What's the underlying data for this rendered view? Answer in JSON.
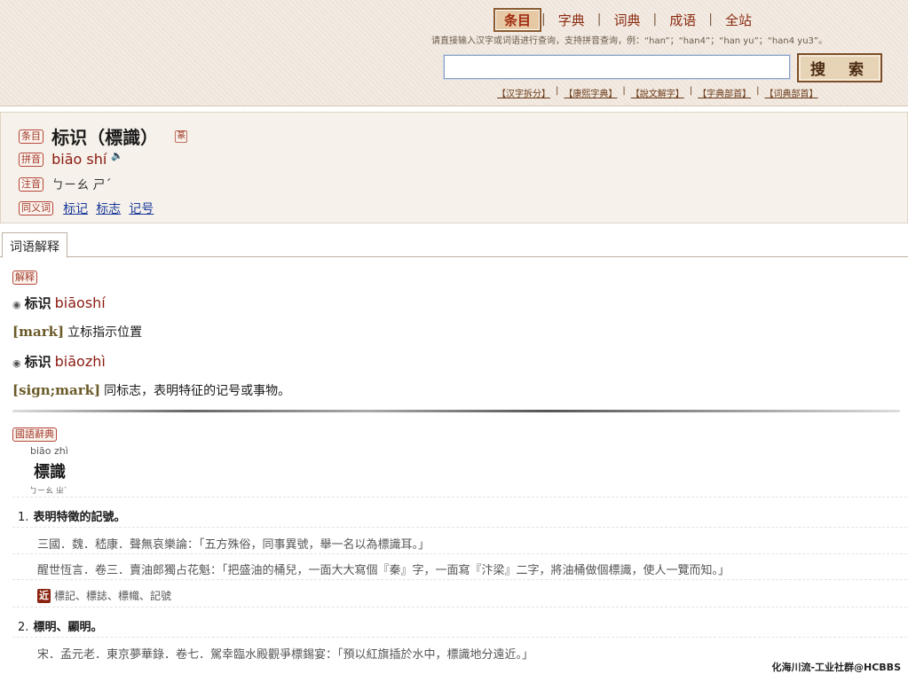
{
  "header": {
    "nav": {
      "active": "条目",
      "items": [
        "字典",
        "词典",
        "成语",
        "全站"
      ]
    },
    "hint": "请直接输入汉字或词语进行查询，支持拼音查询，例：“han”；“han4”；“han yu”；“han4 yu3”。",
    "search": {
      "value": "",
      "button": "搜 索"
    },
    "links": [
      "【汉字拆分】",
      "【康熙字典】",
      "【說文解字】",
      "【字典部首】",
      "【词典部首】"
    ]
  },
  "entry": {
    "tag_title": "条目",
    "title": "标识（標識）",
    "seal_icon": "篆",
    "tag_pinyin": "拼音",
    "pinyin": "biāo shí",
    "speaker_glyph": "🔈",
    "tag_zhuyin": "注音",
    "zhuyin": "ㄅㄧㄠ ㄕˊ",
    "tag_synonym": "同义词",
    "synonyms": [
      "标记",
      "标志",
      "记号"
    ]
  },
  "tabs": {
    "active": "词语解释"
  },
  "definition": {
    "tag": "解释",
    "items": [
      {
        "headword": "标识",
        "pinyin": "biāoshí",
        "english": "[mark]",
        "chinese": "立标指示位置"
      },
      {
        "headword": "标识",
        "pinyin": "biāozhì",
        "english": "[sign;mark]",
        "chinese": "同标志，表明特征的记号或事物。"
      }
    ]
  },
  "guoyu": {
    "tag": "國語辭典",
    "pinyin": "biāo zhì",
    "word": "標識",
    "zhuyin": "ㄅㄧㄠ ㄓˋ",
    "senses": [
      {
        "num": "1.",
        "text": "表明特徵的記號。",
        "quotes": [
          "三國．魏．嵇康．聲無哀樂論：「五方殊俗，同事異號，舉一名以為標識耳。」",
          "醒世恆言．卷三．賣油郎獨占花魁：「把盛油的桶兒，一面大大寫個『秦』字，一面寫『汴梁』二字，將油桶做個標識，使人一覽而知。」"
        ],
        "related_badge": "近",
        "related": "標記、標誌、標幟、記號"
      },
      {
        "num": "2.",
        "text": "標明、顯明。",
        "quotes": [
          "宋．孟元老．東京夢華錄．卷七．駕幸臨水殿觀爭標錫宴：「預以紅旗插於水中，標識地分遠近。」"
        ]
      }
    ]
  },
  "watermark": "化海川流-工业社群@HCBBS"
}
